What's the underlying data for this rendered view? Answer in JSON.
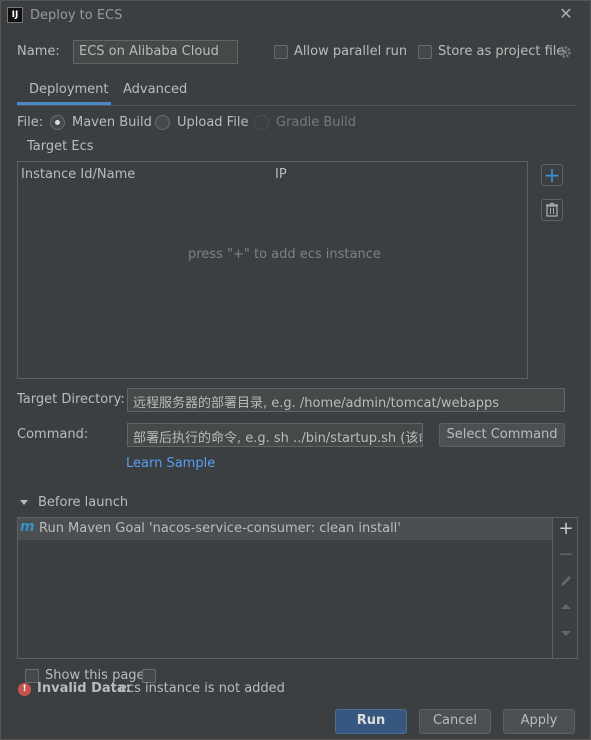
{
  "window": {
    "title": "Deploy to ECS",
    "app_icon_text": "IJ"
  },
  "config": {
    "name_label": "Name:",
    "name_value": "ECS on Alibaba Cloud",
    "allow_parallel_label": "Allow parallel run",
    "store_project_label": "Store as project file"
  },
  "tabs": [
    {
      "label": "Deployment",
      "active": true
    },
    {
      "label": "Advanced",
      "active": false
    }
  ],
  "file": {
    "label": "File:",
    "options": [
      {
        "label": "Maven Build",
        "checked": true,
        "disabled": false
      },
      {
        "label": "Upload File",
        "checked": false,
        "disabled": false
      },
      {
        "label": "Gradle Build",
        "checked": false,
        "disabled": true
      }
    ]
  },
  "target_ecs": {
    "label": "Target Ecs",
    "columns": [
      "Instance Id/Name",
      "IP"
    ],
    "empty_text": "press \"+\" to add ecs instance"
  },
  "target_directory": {
    "label": "Target Directory:",
    "placeholder": "远程服务器的部署目录, e.g. /home/admin/tomcat/webapps"
  },
  "command": {
    "label": "Command:",
    "placeholder": "部署后执行的命令, e.g. sh ../bin/startup.sh (该命令在",
    "select_button": "Select Command"
  },
  "learn_sample": "Learn Sample",
  "before_launch": {
    "label": "Before launch",
    "tasks": [
      {
        "icon": "maven-icon",
        "text": "Run Maven Goal 'nacos-service-consumer: clean install'"
      }
    ]
  },
  "footer": {
    "show_page_label": "Show this page",
    "error_label": "Invalid Data:",
    "error_text": "ecs instance is not added",
    "run": "Run",
    "cancel": "Cancel",
    "apply": "Apply"
  },
  "colors": {
    "background": "#3c3f41",
    "accent": "#4a88c7",
    "primary_button": "#365880",
    "link": "#589df6",
    "error": "#c75450"
  }
}
